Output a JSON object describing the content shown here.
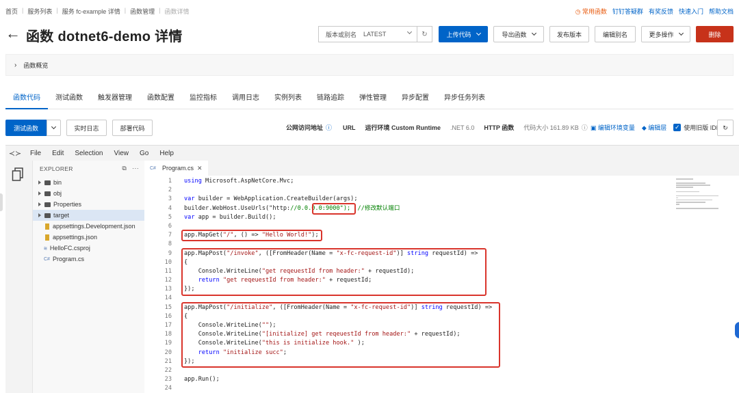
{
  "breadcrumb": [
    "首页",
    "服务列表",
    "服务 fc-example 详情",
    "函数管理",
    "函数详情"
  ],
  "top_links": {
    "hot": "常用函数",
    "links": [
      "钉钉答疑群",
      "有奖反馈",
      "快速入门",
      "帮助文档"
    ]
  },
  "title": "函数 dotnet6-demo 详情",
  "version_select": {
    "label": "版本或别名",
    "value": "LATEST"
  },
  "buttons": {
    "upload": "上传代码",
    "export": "导出函数",
    "publish": "发布版本",
    "edit_alias": "编辑别名",
    "more": "更多操作",
    "delete": "删除"
  },
  "overview": "函数概览",
  "tabs": [
    "函数代码",
    "测试函数",
    "触发器管理",
    "函数配置",
    "监控指标",
    "调用日志",
    "实例列表",
    "链路追踪",
    "弹性管理",
    "异步配置",
    "异步任务列表"
  ],
  "toolbar": {
    "test": "测试函数",
    "live_log": "实时日志",
    "deploy": "部署代码"
  },
  "info": {
    "public_url_label": "公网访问地址",
    "url": "URL",
    "runtime_label": "运行环境 Custom Runtime",
    "runtime_value": ".NET 6.0",
    "http": "HTTP 函数",
    "code_size": "代码大小 161.89 KB",
    "edit_env": "编辑环境变量",
    "edit_layer": "编辑层",
    "legacy_ide": "使用旧版 IDE"
  },
  "ide": {
    "menu": [
      "File",
      "Edit",
      "Selection",
      "View",
      "Go",
      "Help"
    ],
    "explorer_title": "EXPLORER",
    "tree": [
      {
        "name": "bin",
        "type": "folder"
      },
      {
        "name": "obj",
        "type": "folder"
      },
      {
        "name": "Properties",
        "type": "folder"
      },
      {
        "name": "target",
        "type": "folder"
      },
      {
        "name": "appsettings.Development.json",
        "type": "json"
      },
      {
        "name": "appsettings.json",
        "type": "json"
      },
      {
        "name": "HelloFC.csproj",
        "type": "xml"
      },
      {
        "name": "Program.cs",
        "type": "cs"
      }
    ],
    "open_tab": "Program.cs",
    "line_numbers": [
      "1",
      "2",
      "3",
      "4",
      "5",
      "6",
      "7",
      "8",
      "9",
      "10",
      "11",
      "12",
      "13",
      "14",
      "15",
      "16",
      "17",
      "18",
      "19",
      "20",
      "21",
      "22",
      "23",
      "24"
    ],
    "code": [
      "using Microsoft.AspNetCore.Mvc;",
      "",
      "var builder = WebApplication.CreateBuilder(args);",
      "builder.WebHost.UseUrls(\"http://0.0.0.0:9000\");  //修改默认端口",
      "var app = builder.Build();",
      "",
      "app.MapGet(\"/\", () => \"Hello World!\");",
      "",
      "app.MapPost(\"/invoke\", ([FromHeader(Name = \"x-fc-request-id\")] string requestId) =>",
      "{",
      "    Console.WriteLine(\"get reqeuestId from header:\" + requestId);",
      "    return \"get reqeuestId from header:\" + requestId;",
      "});",
      "",
      "app.MapPost(\"/initialize\", ([FromHeader(Name = \"x-fc-request-id\")] string requestId) =>",
      "{",
      "    Console.WriteLine(\"\");",
      "    Console.WriteLine(\"[initialize] get reqeuestId from header:\" + requestId);",
      "    Console.WriteLine(\"this is initialize hook.\" );",
      "    return \"initialize succ\";",
      "});",
      "",
      "app.Run();",
      ""
    ]
  },
  "colors": {
    "primary": "#0064c8",
    "danger": "#c7321a",
    "highlight_box": "#d9342b"
  }
}
